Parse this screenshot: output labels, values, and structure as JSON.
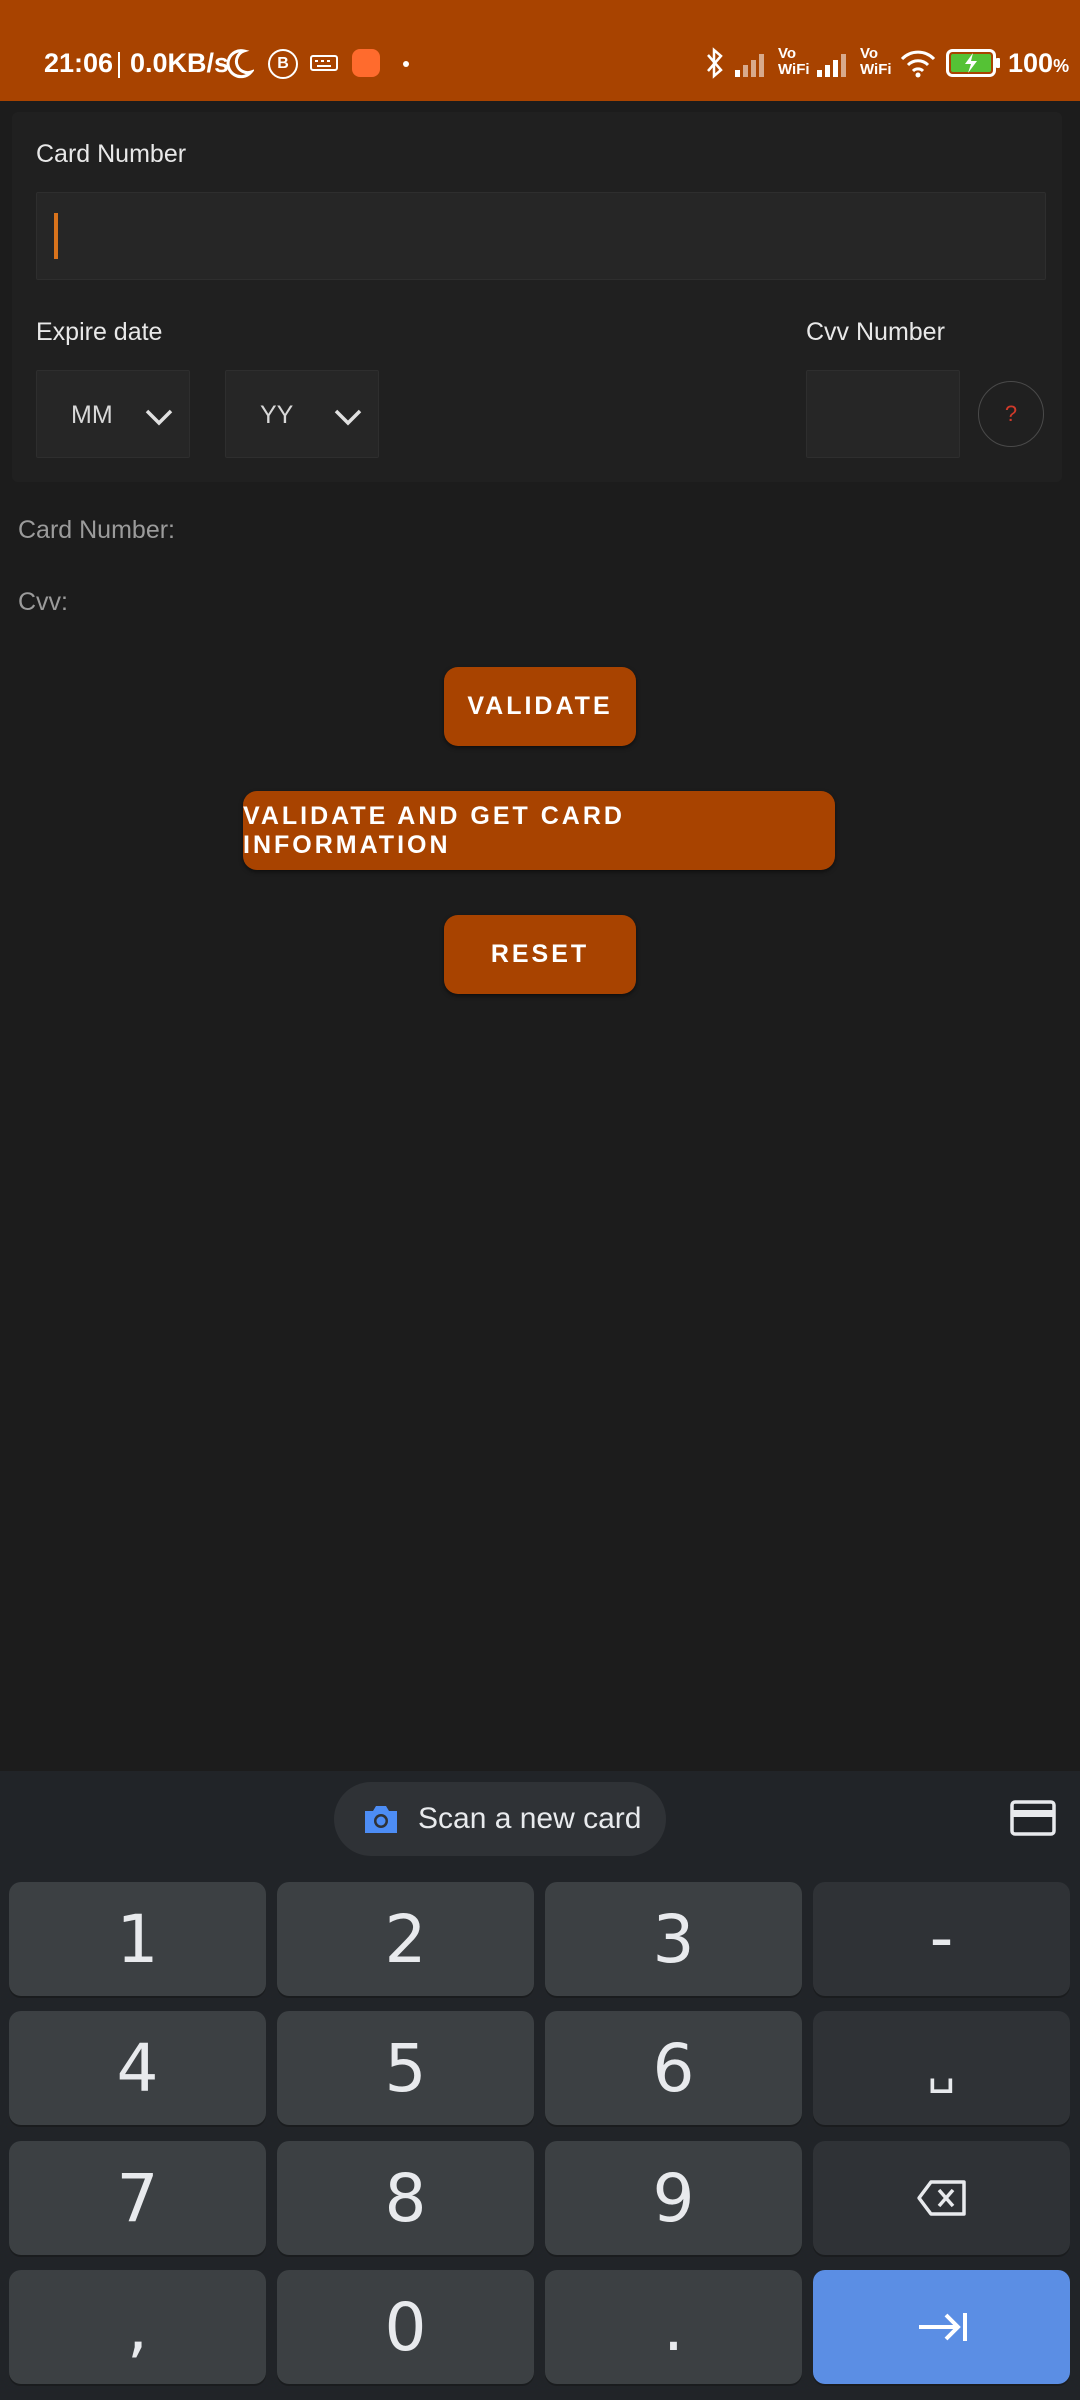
{
  "status_bar": {
    "time": "21:06",
    "speed": "0.0KB/s",
    "battery": "100",
    "battery_unit": "%",
    "vowifi_1": "Vo\nWiFi",
    "vowifi_2": "Vo\nWiFi",
    "badge_b": "B"
  },
  "form": {
    "card_number_label": "Card Number",
    "card_number_value": "",
    "expire_label": "Expire date",
    "month_select": "MM",
    "year_select": "YY",
    "cvv_label": "Cvv Number",
    "cvv_value": "",
    "help_symbol": "?"
  },
  "info": {
    "card_number_label": "Card Number:",
    "cvv_label": "Cvv:"
  },
  "buttons": {
    "validate": "VALIDATE",
    "validate_info": "VALIDATE AND GET CARD INFORMATION",
    "reset": "RESET"
  },
  "keyboard": {
    "scan_label": "Scan a new card",
    "keys": {
      "k1": "1",
      "k2": "2",
      "k3": "3",
      "dash": "–",
      "k4": "4",
      "k5": "5",
      "k6": "6",
      "space": "␣",
      "k7": "7",
      "k8": "8",
      "k9": "9",
      "comma": ",",
      "k0": "0",
      "period": "."
    }
  },
  "colors": {
    "accent": "#a84300",
    "background": "#1c1c1c",
    "caret": "#d9731c",
    "keyboard_action": "#5b8ee4"
  }
}
